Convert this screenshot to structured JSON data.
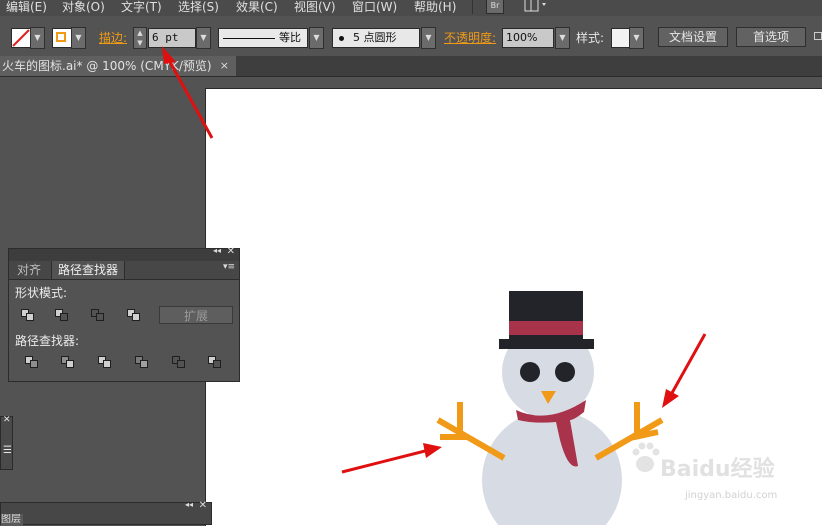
{
  "menu": {
    "items": [
      "编辑(E)",
      "对象(O)",
      "文字(T)",
      "选择(S)",
      "效果(C)",
      "视图(V)",
      "窗口(W)",
      "帮助(H)"
    ],
    "br_label": "Br"
  },
  "control_bar": {
    "stroke_label": "描边:",
    "stroke_weight": "6 pt",
    "uniform_label": "等比",
    "brush_label": "5 点圆形",
    "opacity_label": "不透明度:",
    "opacity_value": "100%",
    "style_label": "样式:",
    "doc_setup_button": "文档设置",
    "preferences_button": "首选项"
  },
  "document_tab": {
    "title": "火车的图标.ai* @ 100% (CMYK/预览)",
    "close": "×"
  },
  "pathfinder_panel": {
    "tabs": [
      "对齐",
      "路径查找器"
    ],
    "active_tab": "路径查找器",
    "shape_modes_label": "形状模式:",
    "expand_button": "扩展",
    "pathfinders_label": "路径查找器:"
  },
  "bottom_panel": {
    "tab_label": "图层"
  },
  "watermark": {
    "text": "Baidu经验",
    "url": "jingyan.baidu.com"
  },
  "colors": {
    "ui_bg": "#535353",
    "artboard": "#ffffff",
    "snow": "#d7dbe3",
    "hat": "#23232a",
    "hat_band": "#a8334a",
    "scarf": "#a8334a",
    "arms": "#f19a17",
    "nose": "#f19a17",
    "arrows": "#e01010"
  }
}
